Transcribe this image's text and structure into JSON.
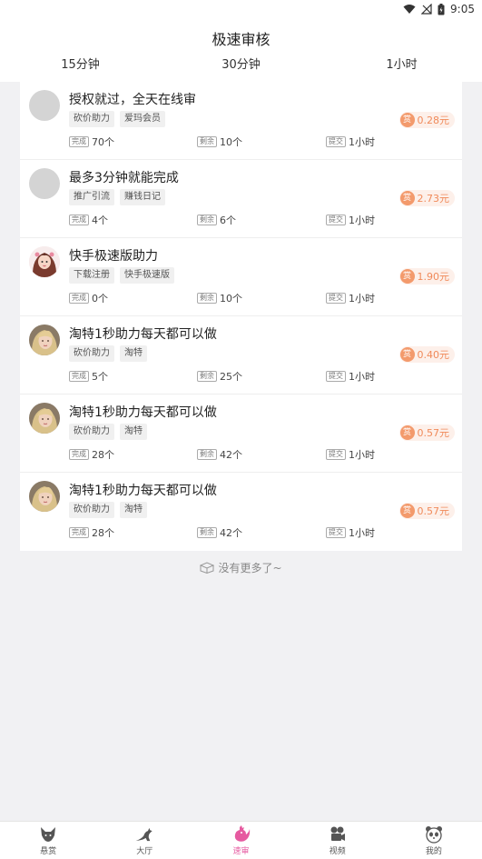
{
  "status": {
    "time": "9:05"
  },
  "header": {
    "title": "极速审核"
  },
  "tabs": [
    "15分钟",
    "30分钟",
    "1小时"
  ],
  "stat_labels": {
    "done": "完成",
    "left": "剩余",
    "submit": "提交"
  },
  "reward_badge": "赏",
  "tasks": [
    {
      "title": "授权就过，全天在线审",
      "tags": [
        "砍价助力",
        "爱玛会员"
      ],
      "done": "70个",
      "left": "10个",
      "submit": "1小时",
      "reward": "0.28元",
      "avatar": "gray-circle"
    },
    {
      "title": "最多3分钟就能完成",
      "tags": [
        "推广引流",
        "赚钱日记"
      ],
      "done": "4个",
      "left": "6个",
      "submit": "1小时",
      "reward": "2.73元",
      "avatar": "gray-circle"
    },
    {
      "title": "快手极速版助力",
      "tags": [
        "下载注册",
        "快手极速版"
      ],
      "done": "0个",
      "left": "10个",
      "submit": "1小时",
      "reward": "1.90元",
      "avatar": "girl-illustration"
    },
    {
      "title": "淘特1秒助力每天都可以做",
      "tags": [
        "砍价助力",
        "淘特"
      ],
      "done": "5个",
      "left": "25个",
      "submit": "1小时",
      "reward": "0.40元",
      "avatar": "blonde-photo"
    },
    {
      "title": "淘特1秒助力每天都可以做",
      "tags": [
        "砍价助力",
        "淘特"
      ],
      "done": "28个",
      "left": "42个",
      "submit": "1小时",
      "reward": "0.57元",
      "avatar": "blonde-photo"
    },
    {
      "title": "淘特1秒助力每天都可以做",
      "tags": [
        "砍价助力",
        "淘特"
      ],
      "done": "28个",
      "left": "42个",
      "submit": "1小时",
      "reward": "0.57元",
      "avatar": "blonde-photo"
    }
  ],
  "footer_note": "没有更多了~",
  "nav": [
    {
      "label": "悬赏",
      "icon": "fox-icon",
      "active": false
    },
    {
      "label": "大厅",
      "icon": "kangaroo-icon",
      "active": false
    },
    {
      "label": "速审",
      "icon": "rooster-icon",
      "active": true
    },
    {
      "label": "视频",
      "icon": "film-camera-icon",
      "active": false
    },
    {
      "label": "我的",
      "icon": "panda-icon",
      "active": false
    }
  ],
  "colors": {
    "accent_pink": "#e65aa0",
    "reward_orange": "#f08a5a",
    "reward_bg": "#fdf0ea"
  }
}
